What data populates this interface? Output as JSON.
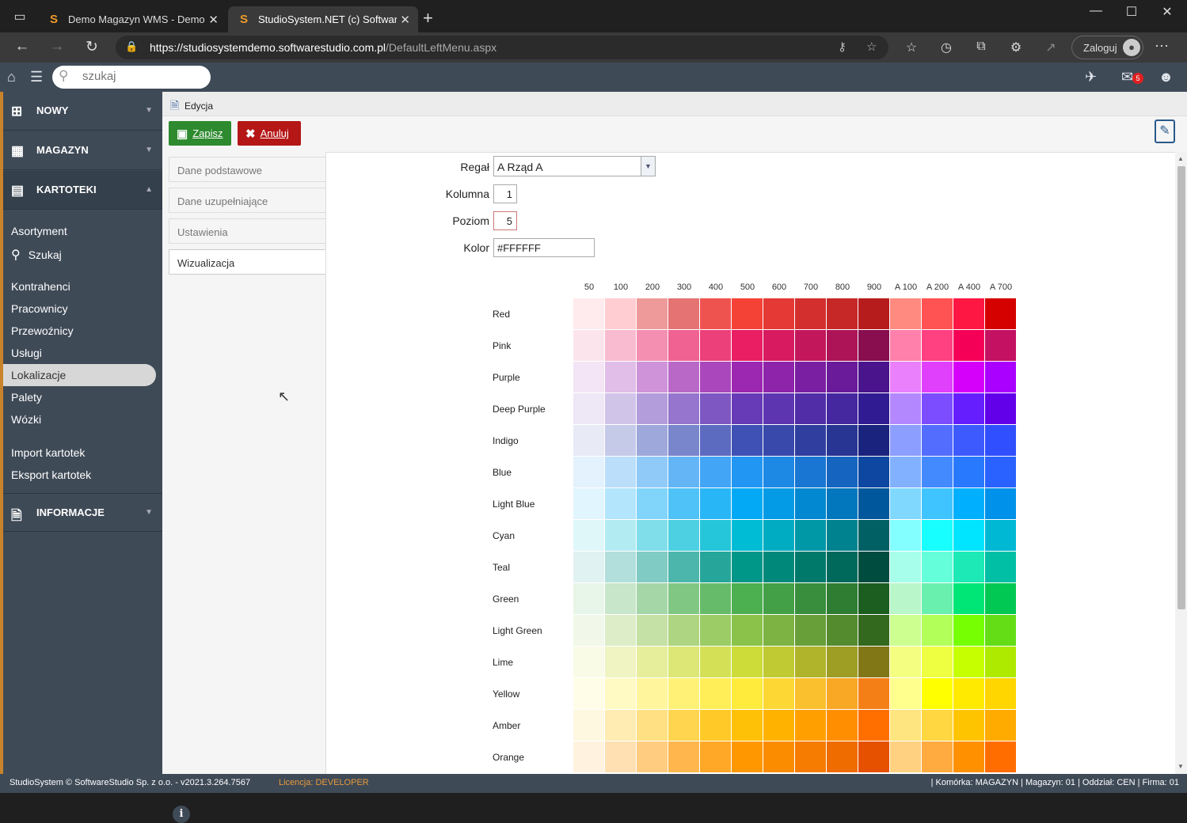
{
  "browser": {
    "tabs": [
      {
        "title": "Demo Magazyn WMS - Demo or",
        "favicon": "S"
      },
      {
        "title": "StudioSystem.NET (c) SoftwareSt",
        "favicon": "S"
      }
    ],
    "url_host": "https://studiosystemdemo.softwarestudio.com.pl",
    "url_path": "/DefaultLeftMenu.aspx",
    "login_label": "Zaloguj"
  },
  "appbar": {
    "search_placeholder": "szukaj",
    "mail_count": "5"
  },
  "sidebar": {
    "sections": [
      {
        "label": "NOWY",
        "icon": "plus-square-icon"
      },
      {
        "label": "MAGAZYN",
        "icon": "pallet-icon"
      },
      {
        "label": "KARTOTEKI",
        "icon": "card-icon"
      },
      {
        "label": "INFORMACJE",
        "icon": "document-icon"
      }
    ],
    "items": [
      "Asortyment",
      "Szukaj",
      "Kontrahenci",
      "Pracownicy",
      "Przewoźnicy",
      "Usługi",
      "Lokalizacje",
      "Palety",
      "Wózki",
      "Import kartotek",
      "Eksport kartotek"
    ],
    "selected": "Lokalizacje"
  },
  "header": {
    "title": "Edycja"
  },
  "toolbar": {
    "save_label": "Zapisz",
    "cancel_label": "Anuluj"
  },
  "panel_tabs": [
    "Dane podstawowe",
    "Dane uzupełniające",
    "Ustawienia",
    "Wizualizacja"
  ],
  "form": {
    "regal_label": "Regał",
    "regal_value": "A Rząd A",
    "kolumna_label": "Kolumna",
    "kolumna_value": "1",
    "poziom_label": "Poziom",
    "poziom_value": "5",
    "kolor_label": "Kolor",
    "kolor_value": "#FFFFFF"
  },
  "palette": {
    "columns": [
      "50",
      "100",
      "200",
      "300",
      "400",
      "500",
      "600",
      "700",
      "800",
      "900",
      "A 100",
      "A 200",
      "A 400",
      "A 700"
    ],
    "rows": [
      {
        "name": "Red",
        "colors": [
          "#ffebee",
          "#ffcdd2",
          "#ef9a9a",
          "#e57373",
          "#ef5350",
          "#f44336",
          "#e53935",
          "#d32f2f",
          "#c62828",
          "#b71c1c",
          "#ff8a80",
          "#ff5252",
          "#ff1744",
          "#d50000"
        ]
      },
      {
        "name": "Pink",
        "colors": [
          "#fce4ec",
          "#f8bbd0",
          "#f48fb1",
          "#f06292",
          "#ec407a",
          "#e91e63",
          "#d81b60",
          "#c2185b",
          "#ad1457",
          "#880e4f",
          "#ff80ab",
          "#ff4081",
          "#f50057",
          "#c51162"
        ]
      },
      {
        "name": "Purple",
        "colors": [
          "#f3e5f5",
          "#e1bee7",
          "#ce93d8",
          "#ba68c8",
          "#ab47bc",
          "#9c27b0",
          "#8e24aa",
          "#7b1fa2",
          "#6a1b9a",
          "#4a148c",
          "#ea80fc",
          "#e040fb",
          "#d500f9",
          "#aa00ff"
        ]
      },
      {
        "name": "Deep Purple",
        "colors": [
          "#ede7f6",
          "#d1c4e9",
          "#b39ddb",
          "#9575cd",
          "#7e57c2",
          "#673ab7",
          "#5e35b1",
          "#512da8",
          "#4527a0",
          "#311b92",
          "#b388ff",
          "#7c4dff",
          "#651fff",
          "#6200ea"
        ]
      },
      {
        "name": "Indigo",
        "colors": [
          "#e8eaf6",
          "#c5cae9",
          "#9fa8da",
          "#7986cb",
          "#5c6bc0",
          "#3f51b5",
          "#3949ab",
          "#303f9f",
          "#283593",
          "#1a237e",
          "#8c9eff",
          "#536dfe",
          "#3d5afe",
          "#304ffe"
        ]
      },
      {
        "name": "Blue",
        "colors": [
          "#e3f2fd",
          "#bbdefb",
          "#90caf9",
          "#64b5f6",
          "#42a5f5",
          "#2196f3",
          "#1e88e5",
          "#1976d2",
          "#1565c0",
          "#0d47a1",
          "#82b1ff",
          "#448aff",
          "#2979ff",
          "#2962ff"
        ]
      },
      {
        "name": "Light Blue",
        "colors": [
          "#e1f5fe",
          "#b3e5fc",
          "#81d4fa",
          "#4fc3f7",
          "#29b6f6",
          "#03a9f4",
          "#039be5",
          "#0288d1",
          "#0277bd",
          "#01579b",
          "#80d8ff",
          "#40c4ff",
          "#00b0ff",
          "#0091ea"
        ]
      },
      {
        "name": "Cyan",
        "colors": [
          "#e0f7fa",
          "#b2ebf2",
          "#80deea",
          "#4dd0e1",
          "#26c6da",
          "#00bcd4",
          "#00acc1",
          "#0097a7",
          "#00838f",
          "#006064",
          "#84ffff",
          "#18ffff",
          "#00e5ff",
          "#00b8d4"
        ]
      },
      {
        "name": "Teal",
        "colors": [
          "#e0f2f1",
          "#b2dfdb",
          "#80cbc4",
          "#4db6ac",
          "#26a69a",
          "#009688",
          "#00897b",
          "#00796b",
          "#00695c",
          "#004d40",
          "#a7ffeb",
          "#64ffda",
          "#1de9b6",
          "#00bfa5"
        ]
      },
      {
        "name": "Green",
        "colors": [
          "#e8f5e9",
          "#c8e6c9",
          "#a5d6a7",
          "#81c784",
          "#66bb6a",
          "#4caf50",
          "#43a047",
          "#388e3c",
          "#2e7d32",
          "#1b5e20",
          "#b9f6ca",
          "#69f0ae",
          "#00e676",
          "#00c853"
        ]
      },
      {
        "name": "Light Green",
        "colors": [
          "#f1f8e9",
          "#dcedc8",
          "#c5e1a5",
          "#aed581",
          "#9ccc65",
          "#8bc34a",
          "#7cb342",
          "#689f38",
          "#558b2f",
          "#33691e",
          "#ccff90",
          "#b2ff59",
          "#76ff03",
          "#64dd17"
        ]
      },
      {
        "name": "Lime",
        "colors": [
          "#f9fbe7",
          "#f0f4c3",
          "#e6ee9c",
          "#dce775",
          "#d4e157",
          "#cddc39",
          "#c0ca33",
          "#afb42b",
          "#9e9d24",
          "#827717",
          "#f4ff81",
          "#eeff41",
          "#c6ff00",
          "#aeea00"
        ]
      },
      {
        "name": "Yellow",
        "colors": [
          "#fffde7",
          "#fff9c4",
          "#fff59d",
          "#fff176",
          "#ffee58",
          "#ffeb3b",
          "#fdd835",
          "#fbc02d",
          "#f9a825",
          "#f57f17",
          "#ffff8d",
          "#ffff00",
          "#ffea00",
          "#ffd600"
        ]
      },
      {
        "name": "Amber",
        "colors": [
          "#fff8e1",
          "#ffecb3",
          "#ffe082",
          "#ffd54f",
          "#ffca28",
          "#ffc107",
          "#ffb300",
          "#ffa000",
          "#ff8f00",
          "#ff6f00",
          "#ffe57f",
          "#ffd740",
          "#ffc400",
          "#ffab00"
        ]
      },
      {
        "name": "Orange",
        "colors": [
          "#fff3e0",
          "#ffe0b2",
          "#ffcc80",
          "#ffb74d",
          "#ffa726",
          "#ff9800",
          "#fb8c00",
          "#f57c00",
          "#ef6c00",
          "#e65100",
          "#ffd180",
          "#ffab40",
          "#ff9100",
          "#ff6d00"
        ]
      }
    ]
  },
  "status": {
    "left": "StudioSystem © SoftwareStudio Sp. z o.o. - v2021.3.264.7567",
    "license_label": "Licencja:",
    "license_value": "DEVELOPER",
    "right": "| Komórka: MAGAZYN | Magazyn: 01 | Oddział: CEN | Firma: 01"
  },
  "colors": {
    "sidebar_bg": "#3f4a57",
    "accent": "#c8832b",
    "save": "#2d8a2e",
    "cancel": "#b51616"
  }
}
